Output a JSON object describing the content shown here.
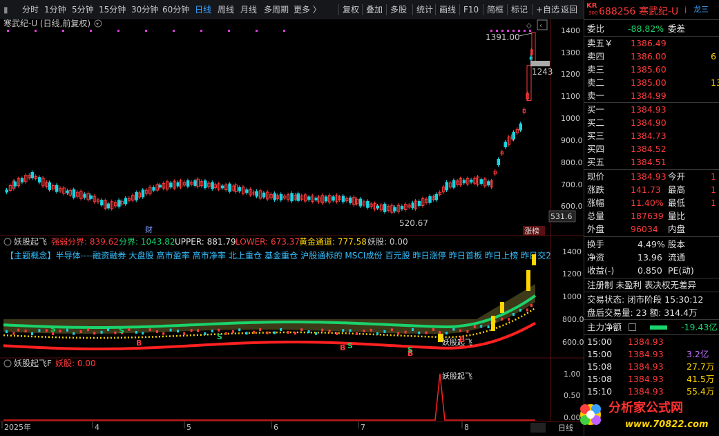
{
  "toolbar": {
    "periods": [
      "分时",
      "1分钟",
      "5分钟",
      "15分钟",
      "30分钟",
      "60分钟",
      "日线",
      "周线",
      "月线",
      "多周期",
      "更多 〉"
    ],
    "active_period": "日线",
    "actions": [
      "复权",
      "叠加",
      "多股",
      "统计",
      "画线",
      "F10",
      "简框",
      "标记",
      "+自选",
      "返回"
    ]
  },
  "main_panel": {
    "title": "寒武纪-U (日线,前复权)",
    "price_axis": [
      "1400",
      "1300",
      "1200",
      "1100",
      "1000",
      "900.0",
      "800.0",
      "700.0",
      "600.0"
    ],
    "high_label": "1391.00",
    "low_label": "520.67",
    "right_box": "1243",
    "last_box": "531.6",
    "cai_label": "财",
    "zhangbang_label": "涨榜"
  },
  "indicator_panel": {
    "name": "妖股起飞",
    "values": [
      {
        "label": "强弱分界: 839.62",
        "color": "#ff3b3b"
      },
      {
        "label": "分界: 1043.82",
        "color": "#19d36b"
      },
      {
        "label": "UPPER: 881.79",
        "color": "#e0e0e0"
      },
      {
        "label": "LOWER: 673.37",
        "color": "#ff3b3b"
      },
      {
        "label": "黄金通道: 777.58",
        "color": "#ffd400"
      },
      {
        "label": "妖股: 0.00",
        "color": "#c8c8c8"
      }
    ],
    "concepts": "【主题概念】半导体----融资融券 大盘股 高市盈率 高市净率 北上重仓 基金重仓 沪股通标的 MSCI成份 百元股 昨日涨停 昨日首板 昨日上榜 昨日交2",
    "price_axis": [
      "1400",
      "1200",
      "1000",
      "800.0",
      "600.0"
    ],
    "signal_text": "妖股起飞",
    "s_marks": [
      "S",
      "S",
      "S",
      "B",
      "B",
      "B",
      "S",
      "S",
      "B"
    ]
  },
  "bottom_panel": {
    "name": "妖股起飞F",
    "value_label": "妖股: 0.00",
    "axis": [
      "1.00",
      "0.50",
      "0.00"
    ],
    "signal_text": "妖股起飞"
  },
  "time_axis": [
    "2025年",
    "4",
    "5",
    "6",
    "7",
    "8"
  ],
  "right_panel": {
    "code_tag": "KR",
    "code_tag_sub": "300",
    "code": "688256",
    "name": "寒武纪-U",
    "info_icon": "i",
    "dragon": "龙三",
    "weibi_label": "委比",
    "weibi": "-88.82%",
    "weicha_label": "委差",
    "asks": [
      {
        "label": "卖五￥",
        "price": "1386.49",
        "vol": ""
      },
      {
        "label": "卖四",
        "price": "1386.00",
        "vol": "6"
      },
      {
        "label": "卖三",
        "price": "1385.60",
        "vol": ""
      },
      {
        "label": "卖二",
        "price": "1385.00",
        "vol": "13"
      },
      {
        "label": "卖一",
        "price": "1384.99",
        "vol": ""
      }
    ],
    "bids": [
      {
        "label": "买一",
        "price": "1384.93"
      },
      {
        "label": "买二",
        "price": "1384.90"
      },
      {
        "label": "买三",
        "price": "1384.73"
      },
      {
        "label": "买四",
        "price": "1384.52"
      },
      {
        "label": "买五",
        "price": "1384.51"
      }
    ],
    "quote": [
      {
        "k1": "现价",
        "v1": "1384.93",
        "k2": "今开",
        "v2": "1"
      },
      {
        "k1": "涨跌",
        "v1": "141.73",
        "k2": "最高",
        "v2": "1"
      },
      {
        "k1": "涨幅",
        "v1": "11.40%",
        "k2": "最低",
        "v2": "1"
      },
      {
        "k1": "总量",
        "v1": "187639",
        "k2": "量比",
        "v2": ""
      },
      {
        "k1": "外盘",
        "v1": "96034",
        "k2": "内盘",
        "v2": ""
      }
    ],
    "stats": [
      {
        "k1": "换手",
        "v1": "4.49%",
        "k2": "股本"
      },
      {
        "k1": "净资",
        "v1": "13.96",
        "k2": "流通"
      },
      {
        "k1": "收益(-)",
        "v1": "0.850",
        "k2": "PE(动)"
      }
    ],
    "status1": "注册制 未盈利 表决权无差异",
    "trade_state": "交易状态: 闭市阶段 15:30:12",
    "after_hours": "盘后交易量: 23  额: 314.4万",
    "net_label": "主力净额",
    "net_value": "-19.43亿",
    "ticks": [
      {
        "t": "15:00",
        "p": "1384.93",
        "v": ""
      },
      {
        "t": "15:00",
        "p": "1384.93",
        "v": "3.2亿"
      },
      {
        "t": "15:08",
        "p": "1384.93",
        "v": "27.7万"
      },
      {
        "t": "15:08",
        "p": "1384.93",
        "v": "41.5万"
      },
      {
        "t": "15:10",
        "p": "1384.93",
        "v": "55.4万"
      }
    ],
    "status_right": "日线"
  },
  "watermark": {
    "brand": "分析家公式网",
    "url": "www.70822.com"
  },
  "colors": {
    "up": "#ff3b3b",
    "down": "#19d3e0",
    "green_band": "#19d36b",
    "red_band": "#ff2020",
    "yellow_dots": "#ffd400",
    "gold_band": "#3d3a1a"
  }
}
